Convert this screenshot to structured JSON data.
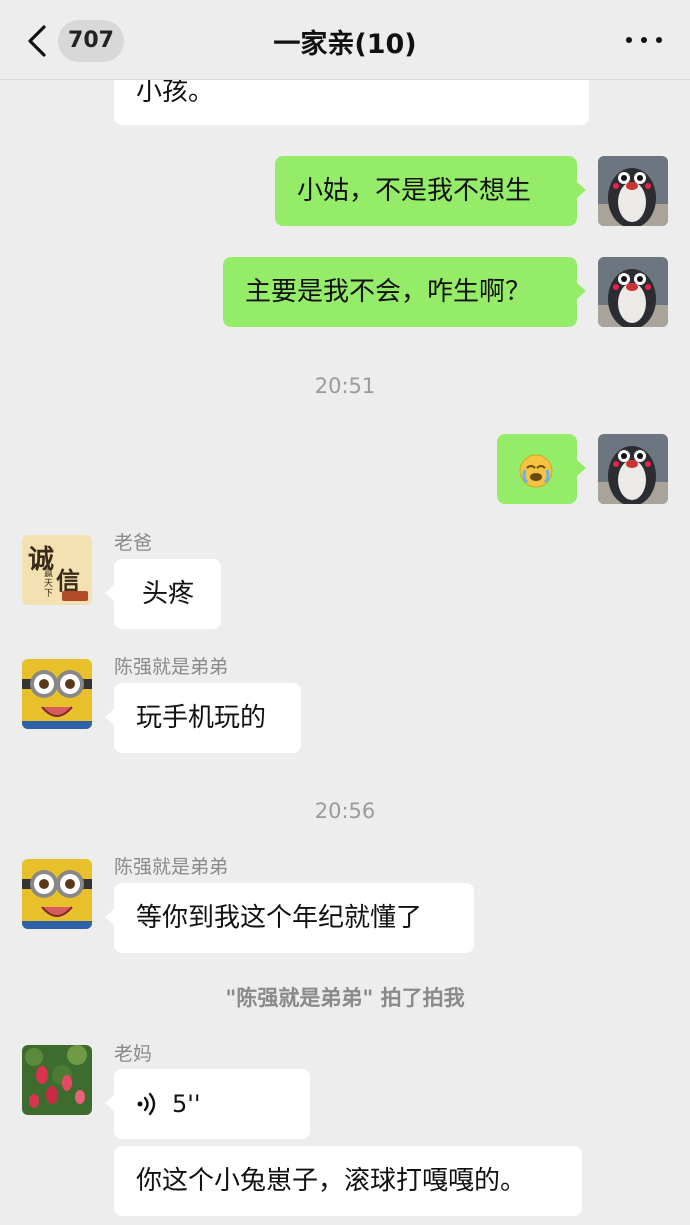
{
  "header": {
    "unread_count": "707",
    "title": "一家亲(10)"
  },
  "messages": {
    "m0": "小孩。",
    "m1": "小姑，不是我不想生",
    "m2": "主要是我不会，咋生啊？",
    "t1": "20:51",
    "m3_icon": "crying-face-emoji",
    "m4_sender": "老爸",
    "m4": "头疼",
    "m5_sender": "陈强就是弟弟",
    "m5": "玩手机玩的",
    "t2": "20:56",
    "m6_sender": "陈强就是弟弟",
    "m6": "等你到我这个年纪就懂了",
    "system": "\"陈强就是弟弟\" 拍了拍我",
    "m7_sender": "老妈",
    "m7_voice": "5''",
    "m8": "你这个小兔崽子，滚球打嘎嘎的。"
  },
  "avatars": {
    "dad_avatar_text_1": "诚",
    "dad_avatar_text_2": "信",
    "dad_avatar_text_3": "赢天下"
  },
  "colors": {
    "background": "#ededed",
    "my_bubble": "#95ec69",
    "other_bubble": "#ffffff"
  }
}
